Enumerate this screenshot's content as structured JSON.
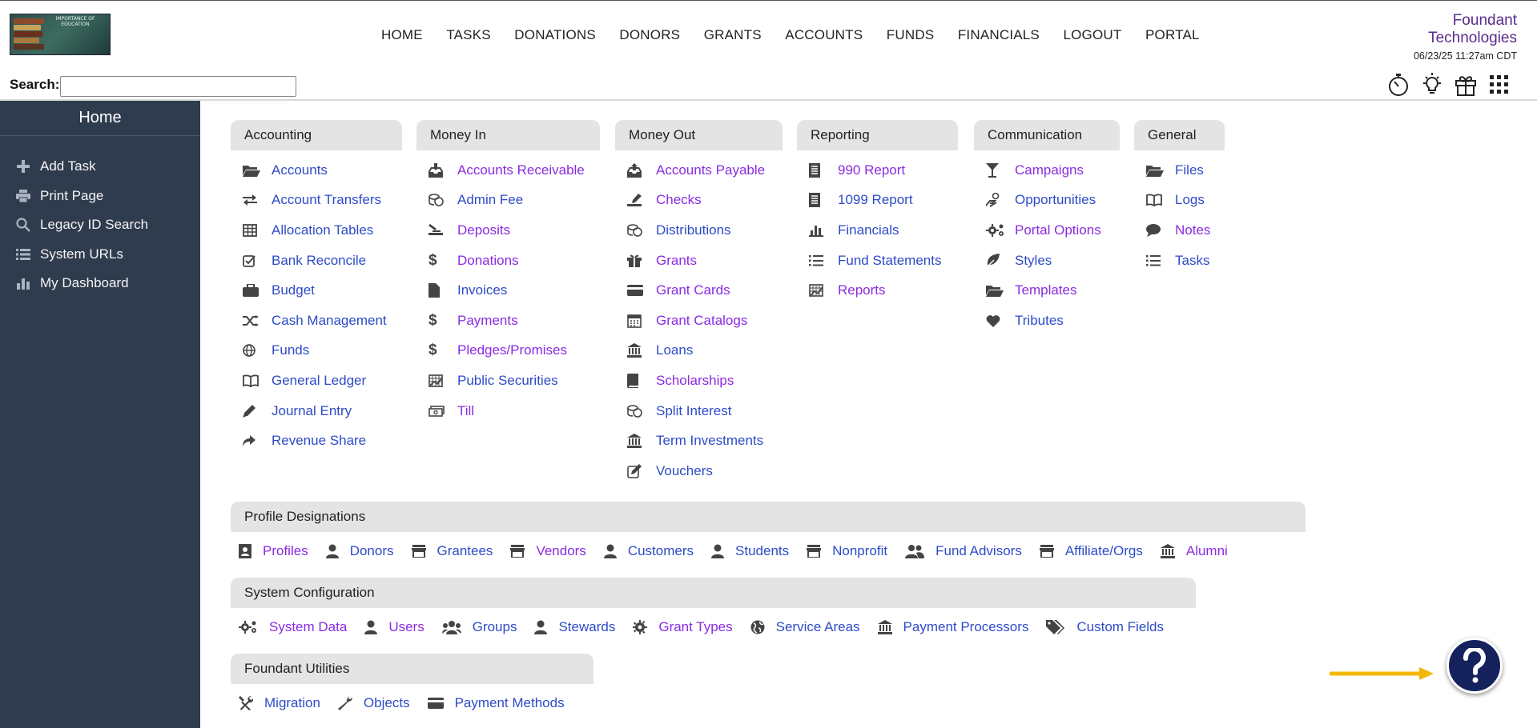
{
  "logo": {
    "text": "IMPORTANCE OF EDUCATION",
    "icon": "books-logo"
  },
  "nav": [
    "HOME",
    "TASKS",
    "DONATIONS",
    "DONORS",
    "GRANTS",
    "ACCOUNTS",
    "FUNDS",
    "FINANCIALS",
    "LOGOUT",
    "PORTAL"
  ],
  "company": {
    "line1": "Foundant",
    "line2": "Technologies",
    "timestamp": "06/23/25 11:27am CDT"
  },
  "search": {
    "label": "Search:",
    "value": "",
    "placeholder": ""
  },
  "header_icons": [
    "stopwatch-icon",
    "lightbulb-icon",
    "gift-icon",
    "apps-grid-icon"
  ],
  "sidebar": {
    "title": "Home",
    "items": [
      {
        "label": "Add Task",
        "icon": "plus-icon"
      },
      {
        "label": "Print Page",
        "icon": "print-icon"
      },
      {
        "label": "Legacy ID Search",
        "icon": "search-icon"
      },
      {
        "label": "System URLs",
        "icon": "list-icon"
      },
      {
        "label": "My Dashboard",
        "icon": "bar-chart-icon"
      }
    ]
  },
  "sections": [
    {
      "title": "Accounting",
      "items": [
        {
          "label": "Accounts",
          "color": "blue",
          "icon": "folder-open-icon"
        },
        {
          "label": "Account Transfers",
          "color": "blue",
          "icon": "exchange-icon"
        },
        {
          "label": "Allocation Tables",
          "color": "blue",
          "icon": "table-icon"
        },
        {
          "label": "Bank Reconcile",
          "color": "blue",
          "icon": "check-square-icon"
        },
        {
          "label": "Budget",
          "color": "blue",
          "icon": "briefcase-icon"
        },
        {
          "label": "Cash Management",
          "color": "blue",
          "icon": "shuffle-icon"
        },
        {
          "label": "Funds",
          "color": "blue",
          "icon": "globe-icon"
        },
        {
          "label": "General Ledger",
          "color": "blue",
          "icon": "book-open-icon"
        },
        {
          "label": "Journal Entry",
          "color": "blue",
          "icon": "pencil-icon"
        },
        {
          "label": "Revenue Share",
          "color": "blue",
          "icon": "share-arrow-icon"
        }
      ]
    },
    {
      "title": "Money In",
      "items": [
        {
          "label": "Accounts Receivable",
          "color": "purple",
          "icon": "inbox-in-icon"
        },
        {
          "label": "Admin Fee",
          "color": "blue",
          "icon": "coins-icon"
        },
        {
          "label": "Deposits",
          "color": "purple",
          "icon": "deposit-icon"
        },
        {
          "label": "Donations",
          "color": "purple",
          "icon": "dollar-icon"
        },
        {
          "label": "Invoices",
          "color": "blue",
          "icon": "file-icon"
        },
        {
          "label": "Payments",
          "color": "purple",
          "icon": "dollar-icon"
        },
        {
          "label": "Pledges/Promises",
          "color": "purple",
          "icon": "dollar-icon"
        },
        {
          "label": "Public Securities",
          "color": "blue",
          "icon": "chart-grid-icon"
        },
        {
          "label": "Till",
          "color": "purple",
          "icon": "money-bill-icon"
        }
      ]
    },
    {
      "title": "Money Out",
      "items": [
        {
          "label": "Accounts Payable",
          "color": "purple",
          "icon": "inbox-out-icon"
        },
        {
          "label": "Checks",
          "color": "purple",
          "icon": "check-write-icon"
        },
        {
          "label": "Distributions",
          "color": "blue",
          "icon": "coins-icon"
        },
        {
          "label": "Grants",
          "color": "purple",
          "icon": "gift-icon"
        },
        {
          "label": "Grant Cards",
          "color": "purple",
          "icon": "credit-card-icon"
        },
        {
          "label": "Grant Catalogs",
          "color": "purple",
          "icon": "calendar-icon"
        },
        {
          "label": "Loans",
          "color": "blue",
          "icon": "bank-icon"
        },
        {
          "label": "Scholarships",
          "color": "purple",
          "icon": "book-icon"
        },
        {
          "label": "Split Interest",
          "color": "blue",
          "icon": "coins-icon"
        },
        {
          "label": "Term Investments",
          "color": "blue",
          "icon": "bank-icon"
        },
        {
          "label": "Vouchers",
          "color": "blue",
          "icon": "edit-icon"
        }
      ]
    },
    {
      "title": "Reporting",
      "items": [
        {
          "label": "990 Report",
          "color": "purple",
          "icon": "document-icon"
        },
        {
          "label": "1099 Report",
          "color": "blue",
          "icon": "document-icon"
        },
        {
          "label": "Financials",
          "color": "blue",
          "icon": "bar-chart-icon"
        },
        {
          "label": "Fund Statements",
          "color": "blue",
          "icon": "list-icon"
        },
        {
          "label": "Reports",
          "color": "purple",
          "icon": "chart-grid-icon"
        }
      ]
    },
    {
      "title": "Communication",
      "items": [
        {
          "label": "Campaigns",
          "color": "purple",
          "icon": "cocktail-icon"
        },
        {
          "label": "Opportunities",
          "color": "blue",
          "icon": "hand-coin-icon"
        },
        {
          "label": "Portal Options",
          "color": "purple",
          "icon": "gears-icon"
        },
        {
          "label": "Styles",
          "color": "blue",
          "icon": "leaf-icon"
        },
        {
          "label": "Templates",
          "color": "purple",
          "icon": "folder-open-icon"
        },
        {
          "label": "Tributes",
          "color": "blue",
          "icon": "heart-icon"
        }
      ]
    },
    {
      "title": "General",
      "items": [
        {
          "label": "Files",
          "color": "blue",
          "icon": "folder-open-icon"
        },
        {
          "label": "Logs",
          "color": "blue",
          "icon": "book-open-icon"
        },
        {
          "label": "Notes",
          "color": "purple",
          "icon": "comment-icon"
        },
        {
          "label": "Tasks",
          "color": "blue",
          "icon": "list-icon"
        }
      ]
    }
  ],
  "profile_designations": {
    "title": "Profile Designations",
    "items": [
      {
        "label": "Profiles",
        "color": "purple",
        "icon": "id-card-icon"
      },
      {
        "label": "Donors",
        "color": "blue",
        "icon": "user-icon"
      },
      {
        "label": "Grantees",
        "color": "blue",
        "icon": "store-icon"
      },
      {
        "label": "Vendors",
        "color": "purple",
        "icon": "store-icon"
      },
      {
        "label": "Customers",
        "color": "blue",
        "icon": "user-icon"
      },
      {
        "label": "Students",
        "color": "blue",
        "icon": "user-icon"
      },
      {
        "label": "Nonprofit",
        "color": "blue",
        "icon": "store-icon"
      },
      {
        "label": "Fund Advisors",
        "color": "blue",
        "icon": "users-icon"
      },
      {
        "label": "Affiliate/Orgs",
        "color": "blue",
        "icon": "store-icon"
      },
      {
        "label": "Alumni",
        "color": "purple",
        "icon": "bank-icon"
      }
    ]
  },
  "system_configuration": {
    "title": "System Configuration",
    "items": [
      {
        "label": "System Data",
        "color": "purple",
        "icon": "gears-icon"
      },
      {
        "label": "Users",
        "color": "purple",
        "icon": "user-icon"
      },
      {
        "label": "Groups",
        "color": "blue",
        "icon": "users-icon"
      },
      {
        "label": "Stewards",
        "color": "blue",
        "icon": "user-icon"
      },
      {
        "label": "Grant Types",
        "color": "purple",
        "icon": "gear-icon"
      },
      {
        "label": "Service Areas",
        "color": "blue",
        "icon": "globe-icon"
      },
      {
        "label": "Payment Processors",
        "color": "blue",
        "icon": "bank-icon"
      },
      {
        "label": "Custom Fields",
        "color": "blue",
        "icon": "tags-icon"
      }
    ]
  },
  "foundant_utilities": {
    "title": "Foundant Utilities",
    "items": [
      {
        "label": "Migration",
        "color": "blue",
        "icon": "tools-icon"
      },
      {
        "label": "Objects",
        "color": "blue",
        "icon": "wrench-icon"
      },
      {
        "label": "Payment Methods",
        "color": "blue",
        "icon": "credit-card-icon"
      }
    ]
  },
  "help": {
    "icon": "question-icon"
  },
  "colors": {
    "link_blue": "#2e4bc7",
    "link_purple": "#8a2be2",
    "sidebar_bg": "#2f3c4e",
    "section_bg": "#e4e4e4",
    "help_bg": "#15225e",
    "arrow": "#f2b705"
  }
}
